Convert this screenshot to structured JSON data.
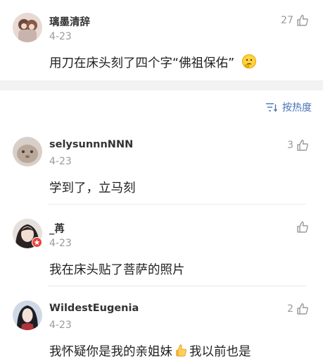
{
  "top_comment": {
    "username": "璃墨清辞",
    "date": "4-23",
    "likes": "27",
    "text": "用刀在床头刻了四个字“佛祖保佑”",
    "emoji_icon": "thinking-face-emoji"
  },
  "sort": {
    "label": "按热度",
    "icon": "sort-icon"
  },
  "replies": [
    {
      "username": "selysunnnNNN",
      "date": "4-23",
      "likes": "3",
      "text": "学到了，立马刻"
    },
    {
      "username": "_苒",
      "date": "4-23",
      "likes": "",
      "text": "我在床头贴了菩萨的照片",
      "badge": "verified-badge"
    },
    {
      "username": "WildestEugenia",
      "date": "4-23",
      "likes": "2",
      "text": "我怀疑你是我的亲姐妹",
      "text_after": "我以前也是",
      "emoji_icon": "thumbs-up-emoji"
    }
  ],
  "colors": {
    "accent": "#4a72b8",
    "muted": "#9a9a9a",
    "separator": "#f2f2f2"
  }
}
